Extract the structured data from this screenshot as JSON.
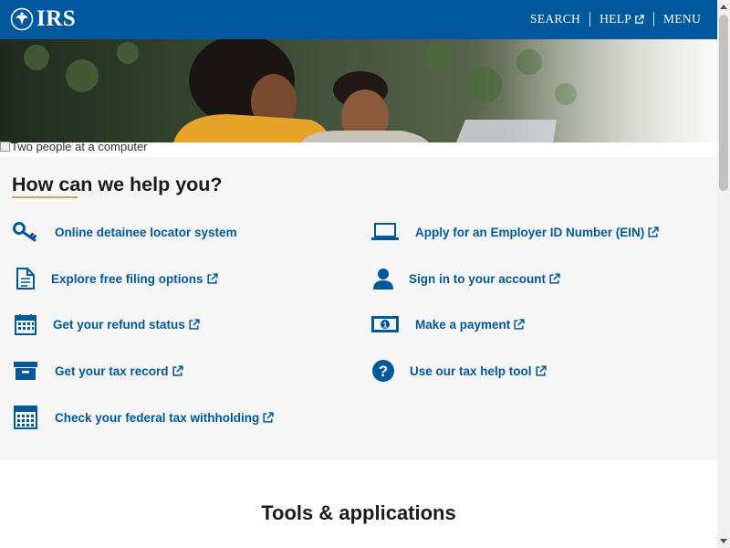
{
  "header": {
    "logo_text": "IRS",
    "nav": {
      "search": "SEARCH",
      "help": "HELP",
      "menu": "MENU"
    }
  },
  "hero": {
    "alt_text": "Two people at a computer"
  },
  "help_section": {
    "title": "How can we help you?",
    "left_links": [
      {
        "label": "Online detainee locator system",
        "icon": "key-icon",
        "external": false
      },
      {
        "label": "Explore free filing options",
        "icon": "document-icon",
        "external": true
      },
      {
        "label": "Get your refund status",
        "icon": "calendar-icon",
        "external": true
      },
      {
        "label": "Get your tax record",
        "icon": "archive-box-icon",
        "external": true
      },
      {
        "label": "Check your federal tax withholding",
        "icon": "calculator-icon",
        "external": true
      }
    ],
    "right_links": [
      {
        "label": "Apply for an Employer ID Number (EIN)",
        "icon": "laptop-icon",
        "external": true
      },
      {
        "label": "Sign in to your account",
        "icon": "user-icon",
        "external": true
      },
      {
        "label": "Make a payment",
        "icon": "money-bill-icon",
        "external": true
      },
      {
        "label": "Use our tax help tool",
        "icon": "question-circle-icon",
        "external": true
      }
    ]
  },
  "tools_section": {
    "title": "Tools & applications"
  },
  "colors": {
    "header_bg": "#00599c",
    "link": "#00599c",
    "accent_underline": "#c9a86a",
    "section_bg": "#f6f6f6"
  }
}
